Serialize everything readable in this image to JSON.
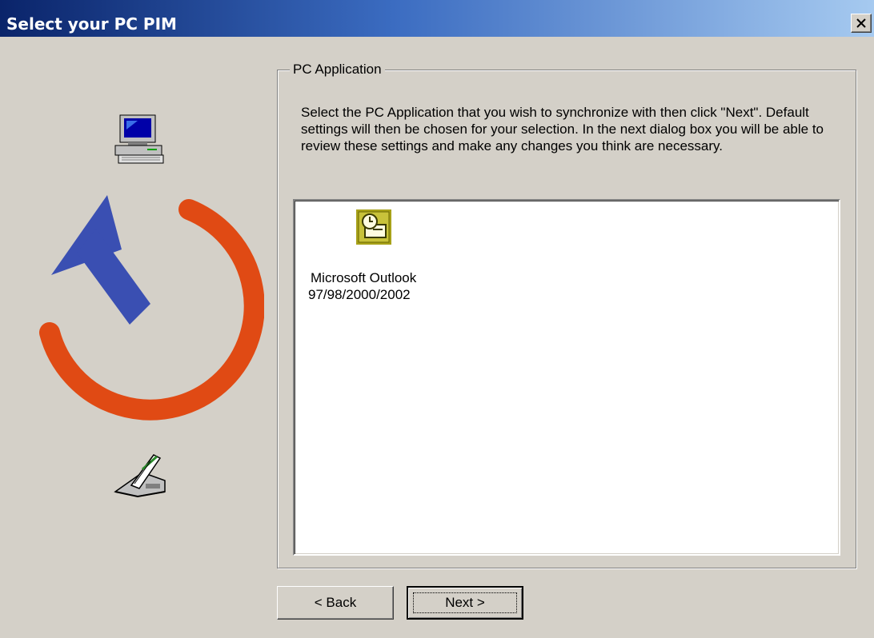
{
  "window": {
    "title": "Select your PC PIM",
    "close_glyph": "✕",
    "titlebar_colors": [
      "#0a246a",
      "#3b6cc1",
      "#a6caf0"
    ]
  },
  "left_panel": {
    "icons": [
      "pc-computer-icon",
      "sync-arrow-graphic",
      "handheld-cradle-icon"
    ],
    "accent_colors": {
      "arrow": "#3a4fb2",
      "ring": "#e04a14"
    }
  },
  "group": {
    "legend": "PC Application",
    "instructions": "Select the PC Application that you wish to synchronize with then click \"Next\". Default settings will then be chosen for your selection. In the next dialog box you will be able to review these settings and make any changes you think are necessary."
  },
  "app_list": {
    "items": [
      {
        "icon": "outlook-icon",
        "name_line1": "Microsoft Outlook",
        "name_line2": "97/98/2000/2002"
      }
    ]
  },
  "buttons": {
    "back": "< Back",
    "next": "Next >"
  }
}
